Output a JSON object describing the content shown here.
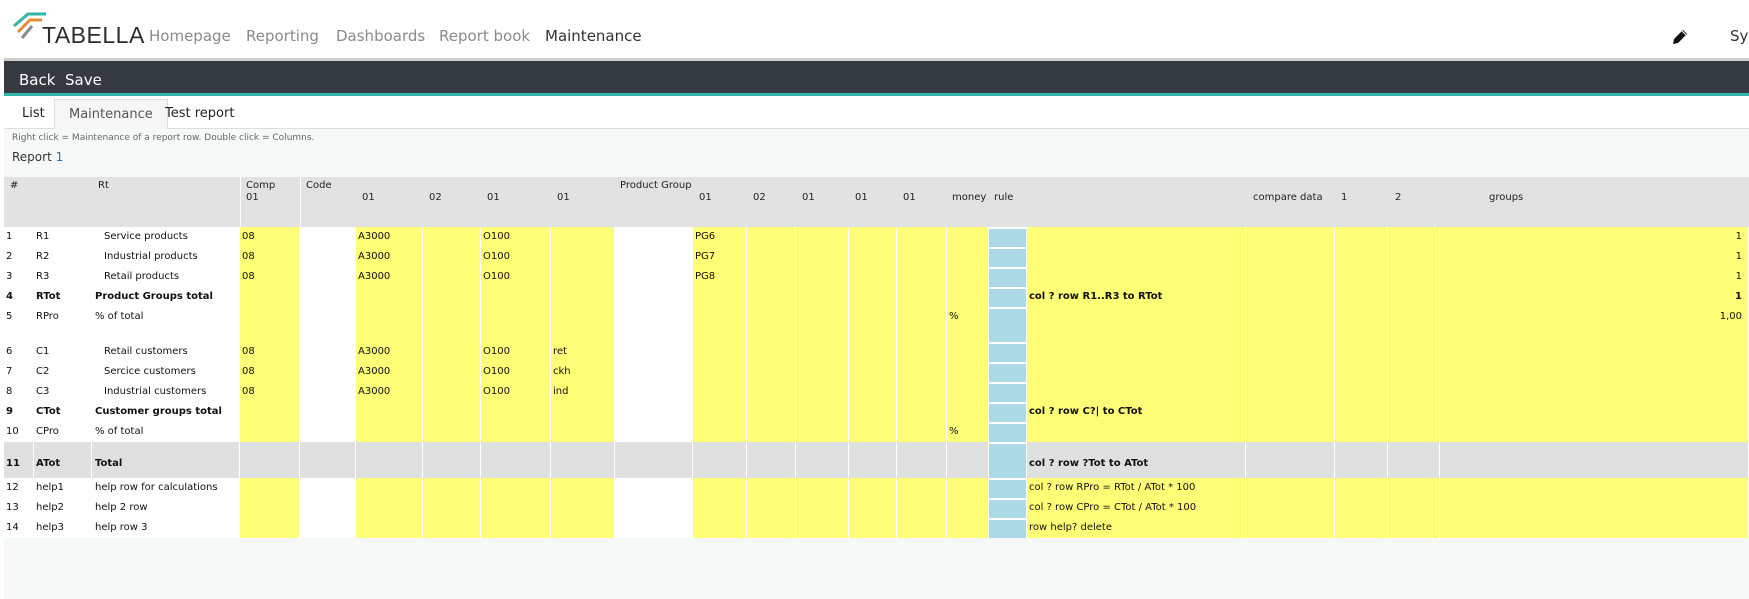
{
  "brand": {
    "name": "TABELLA",
    "colors": {
      "teal": "#2fb6a9",
      "orange": "#e8893a",
      "dark": "#343a40",
      "yellow": "#ffff77",
      "lightblue": "#add8e6"
    }
  },
  "nav": [
    "Homepage",
    "Reporting",
    "Dashboards",
    "Report book",
    "Maintenance"
  ],
  "user": "Sys",
  "toolbar": {
    "back": "Back",
    "save": "Save"
  },
  "tabs": [
    "List",
    "Maintenance",
    "Test report"
  ],
  "hint": "Right click = Maintenance of a report row. Double click = Columns.",
  "report": {
    "label": "Report",
    "number": "1"
  },
  "header": {
    "hash": "#",
    "rt": "Rt",
    "comp": "Comp",
    "comp_sub": "01",
    "code": "Code",
    "code_subs": [
      "01",
      "02",
      "01",
      "01"
    ],
    "product_group": "Product Group",
    "pg_subs": [
      "01",
      "02",
      "01",
      "01",
      "01"
    ],
    "money": "money",
    "rule": "rule",
    "compare": "compare data",
    "c1": "1",
    "c2": "2",
    "groups": "groups"
  },
  "rows": [
    {
      "n": "1",
      "id": "R1",
      "label": "Service products",
      "indent": true,
      "comp": "08",
      "code1": "A3000",
      "code3": "O100",
      "code4": "",
      "pg1": "PG6",
      "money": "",
      "rule_text": "",
      "groups": "1",
      "bold": false,
      "style": "normal"
    },
    {
      "n": "2",
      "id": "R2",
      "label": "Industrial products",
      "indent": true,
      "comp": "08",
      "code1": "A3000",
      "code3": "O100",
      "code4": "",
      "pg1": "PG7",
      "money": "",
      "rule_text": "",
      "groups": "1",
      "bold": false,
      "style": "normal"
    },
    {
      "n": "3",
      "id": "R3",
      "label": "Retail products",
      "indent": true,
      "comp": "08",
      "code1": "A3000",
      "code3": "O100",
      "code4": "",
      "pg1": "PG8",
      "money": "",
      "rule_text": "",
      "groups": "1",
      "bold": false,
      "style": "normal"
    },
    {
      "n": "4",
      "id": "RTot",
      "label": "Product Groups total",
      "indent": false,
      "comp": "",
      "code1": "",
      "code3": "",
      "code4": "",
      "pg1": "",
      "money": "",
      "rule_text": "col ? row R1..R3 to RTot",
      "groups": "1",
      "bold": true,
      "style": "normal"
    },
    {
      "n": "5",
      "id": "RPro",
      "label": "% of total",
      "indent": false,
      "comp": "",
      "code1": "",
      "code3": "",
      "code4": "",
      "pg1": "",
      "money": "%",
      "rule_text": "",
      "groups": "1,00",
      "bold": false,
      "style": "tall"
    },
    {
      "n": "6",
      "id": "C1",
      "label": "Retail customers",
      "indent": true,
      "comp": "08",
      "code1": "A3000",
      "code3": "O100",
      "code4": "ret",
      "pg1": "",
      "money": "",
      "rule_text": "",
      "groups": "",
      "bold": false,
      "style": "normal"
    },
    {
      "n": "7",
      "id": "C2",
      "label": "Sercice customers",
      "indent": true,
      "comp": "08",
      "code1": "A3000",
      "code3": "O100",
      "code4": "ckh",
      "pg1": "",
      "money": "",
      "rule_text": "",
      "groups": "",
      "bold": false,
      "style": "normal"
    },
    {
      "n": "8",
      "id": "C3",
      "label": "Industrial customers",
      "indent": true,
      "comp": "08",
      "code1": "A3000",
      "code3": "O100",
      "code4": "ind",
      "pg1": "",
      "money": "",
      "rule_text": "",
      "groups": "",
      "bold": false,
      "style": "normal"
    },
    {
      "n": "9",
      "id": "CTot",
      "label": "Customer groups total",
      "indent": false,
      "comp": "",
      "code1": "",
      "code3": "",
      "code4": "",
      "pg1": "",
      "money": "",
      "rule_text": "col ? row C?| to CTot",
      "groups": "",
      "bold": true,
      "style": "normal"
    },
    {
      "n": "10",
      "id": "CPro",
      "label": "% of total",
      "indent": false,
      "comp": "",
      "code1": "",
      "code3": "",
      "code4": "",
      "pg1": "",
      "money": "%",
      "rule_text": "",
      "groups": "",
      "bold": false,
      "style": "normal"
    },
    {
      "n": "11",
      "id": "ATot",
      "label": "Total",
      "indent": false,
      "comp": "",
      "code1": "",
      "code3": "",
      "code4": "",
      "pg1": "",
      "money": "",
      "rule_text": "col ? row ?Tot to ATot",
      "groups": "",
      "bold": true,
      "style": "grey"
    },
    {
      "n": "12",
      "id": "help1",
      "label": "help row for calculations",
      "indent": false,
      "comp": "",
      "code1": "",
      "code3": "",
      "code4": "",
      "pg1": "",
      "money": "",
      "rule_text": "col ? row RPro = RTot / ATot * 100",
      "groups": "",
      "bold": false,
      "style": "normal"
    },
    {
      "n": "13",
      "id": "help2",
      "label": "help 2 row",
      "indent": false,
      "comp": "",
      "code1": "",
      "code3": "",
      "code4": "",
      "pg1": "",
      "money": "",
      "rule_text": "col ? row CPro = CTot / ATot * 100",
      "groups": "",
      "bold": false,
      "style": "normal"
    },
    {
      "n": "14",
      "id": "help3",
      "label": "help row 3",
      "indent": false,
      "comp": "",
      "code1": "",
      "code3": "",
      "code4": "",
      "pg1": "",
      "money": "",
      "rule_text": "row help? delete",
      "groups": "",
      "bold": false,
      "style": "normal"
    }
  ]
}
